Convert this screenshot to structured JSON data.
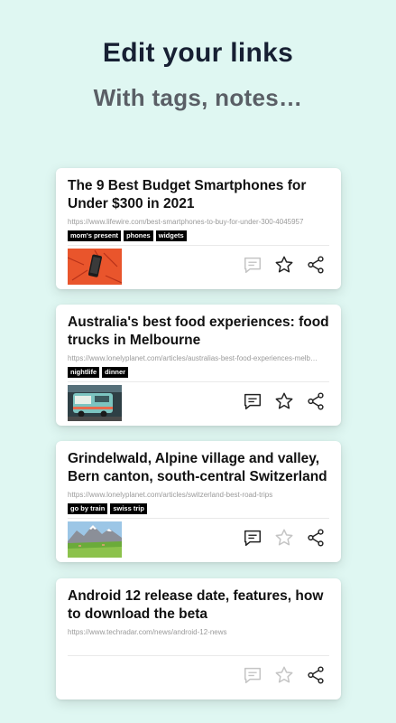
{
  "header": {
    "title": "Edit your links",
    "subtitle": "With tags, notes…"
  },
  "cards": [
    {
      "title": "The 9 Best Budget Smartphones for Under $300 in 2021",
      "url": "https://www.lifewire.com/best-smartphones-to-buy-for-under-300-4045957",
      "tags": [
        "mom's present",
        "phones",
        "widgets"
      ],
      "thumbnail": "phone-on-orange",
      "note_active": false,
      "favorite_active": true
    },
    {
      "title": "Australia's best food experiences: food trucks in Melbourne",
      "url": "https://www.lonelyplanet.com/articles/australias-best-food-experiences-melb…",
      "tags": [
        "nightlife",
        "dinner"
      ],
      "thumbnail": "food-truck",
      "note_active": true,
      "favorite_active": true
    },
    {
      "title": "Grindelwald, Alpine village and valley, Bern canton, south-central Switzerland",
      "url": "https://www.lonelyplanet.com/articles/switzerland-best-road-trips",
      "tags": [
        "go by train",
        "swiss trip"
      ],
      "thumbnail": "alpine-valley",
      "note_active": true,
      "favorite_active": false
    },
    {
      "title": "Android 12 release date, features, how to download the beta",
      "url": "https://www.techradar.com/news/android-12-news",
      "tags": [],
      "thumbnail": null,
      "note_active": false,
      "favorite_active": false
    }
  ],
  "colors": {
    "background": "#dff7f2",
    "title": "#172033",
    "subtitle": "#5a5f66",
    "icon_active": "#222222",
    "icon_inactive": "#c4c4c4"
  }
}
